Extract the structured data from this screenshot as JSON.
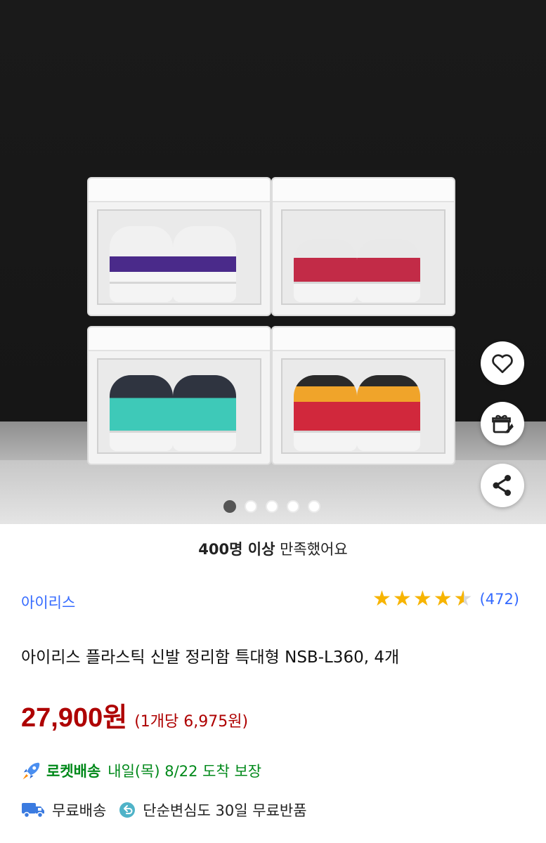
{
  "satisfaction": {
    "bold": "400명 이상",
    "rest": " 만족했어요"
  },
  "product": {
    "brand": "아이리스",
    "rating_stars": 4.5,
    "review_count": "(472)",
    "title": "아이리스 플라스틱 신발 정리함 특대형 NSB-L360, 4개",
    "price": "27,900원",
    "unit_price": "(1개당 6,975원)"
  },
  "delivery": {
    "rocket_label": "로켓배송",
    "arrival": "내일(목) 8/22 도착 보장"
  },
  "badges": {
    "free_shipping": "무료배송",
    "free_return": "단순변심도 30일 무료반품"
  },
  "gallery": {
    "total": 5,
    "active_index": 0
  },
  "icons": {
    "wishlist": "heart-icon",
    "gift": "gift-icon",
    "share": "share-icon",
    "rocket": "rocket-icon",
    "truck": "truck-icon",
    "return": "return-icon"
  },
  "colors": {
    "brand_link": "#346aff",
    "price": "#ae0000",
    "rocket_green": "#00891a",
    "star": "#f7b400"
  }
}
